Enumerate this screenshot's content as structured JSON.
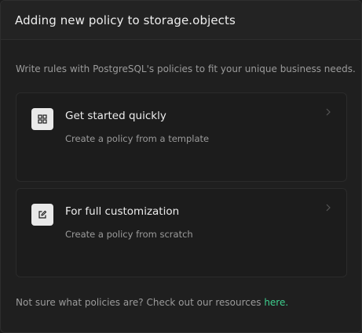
{
  "modal": {
    "title": "Adding new policy to storage.objects",
    "description": "Write rules with PostgreSQL's policies to fit your unique business needs."
  },
  "cards": [
    {
      "title": "Get started quickly",
      "subtitle": "Create a policy from a template",
      "icon": "grid-icon"
    },
    {
      "title": "For full customization",
      "subtitle": "Create a policy from scratch",
      "icon": "edit-icon"
    }
  ],
  "footer": {
    "text": "Not sure what policies are? Check out our resources ",
    "link_label": "here."
  },
  "colors": {
    "accent": "#3ecf8e",
    "background": "#1f1f1f",
    "card_background": "#1c1c1c",
    "text_primary": "#ededed",
    "text_secondary": "#9b9b9b"
  }
}
